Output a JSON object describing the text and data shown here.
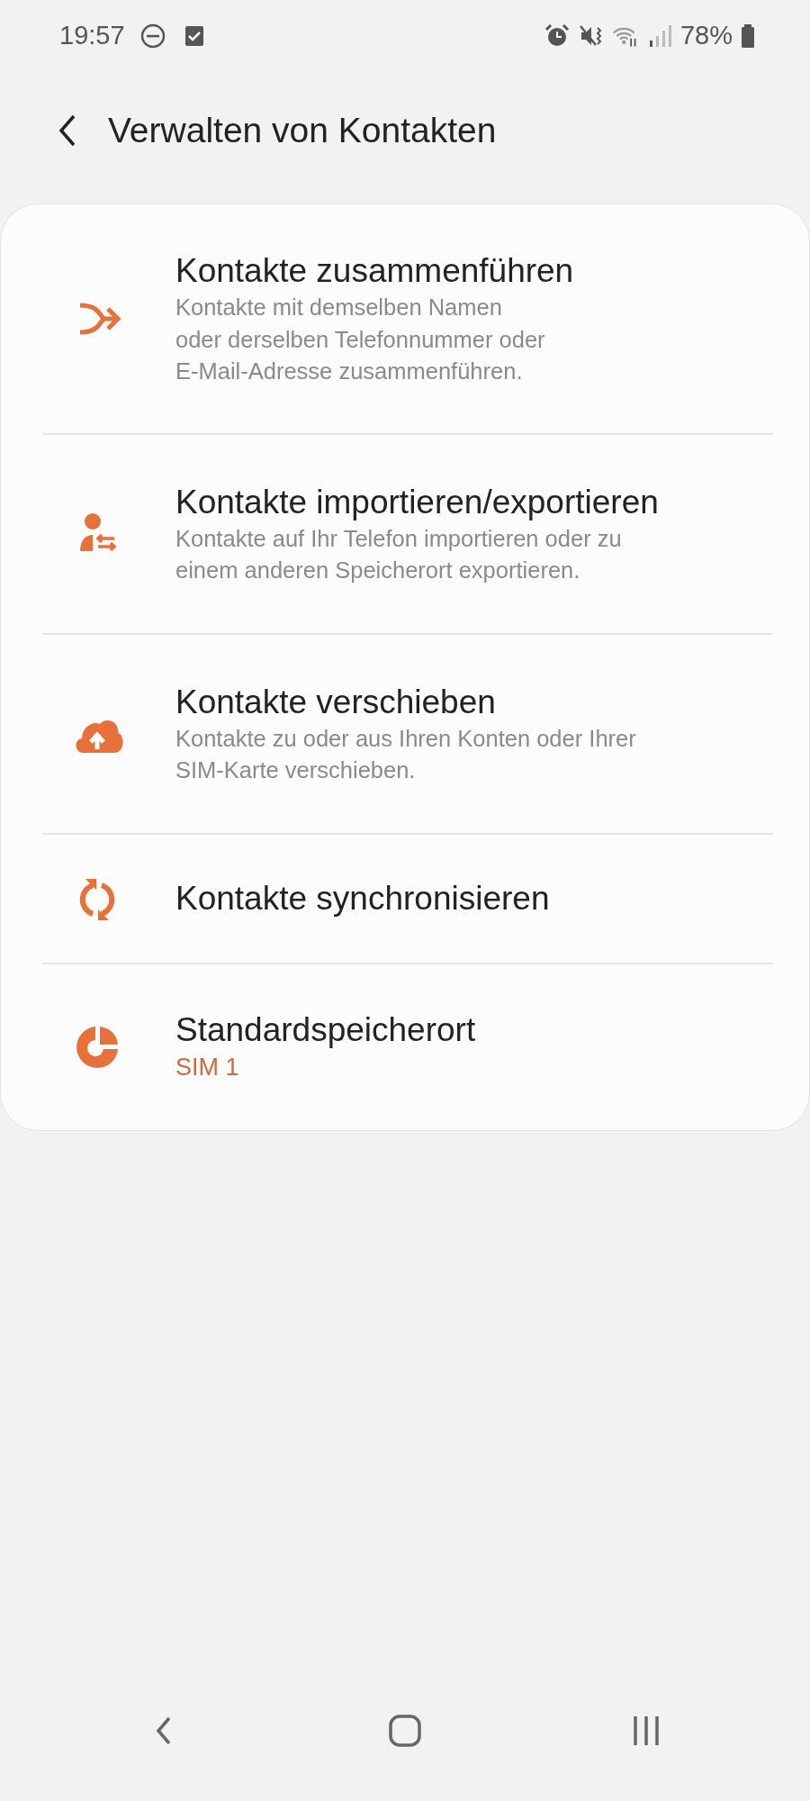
{
  "status_bar": {
    "time": "19:57",
    "battery": "78%"
  },
  "header": {
    "title": "Verwalten von Kontakten"
  },
  "items": [
    {
      "title": "Kontakte zusammenführen",
      "subtitle": "Kontakte mit demselben Namen\noder derselben Telefonnummer oder\nE-Mail-Adresse zusammenführen."
    },
    {
      "title": "Kontakte importieren/exportieren",
      "subtitle": "Kontakte auf Ihr Telefon importieren oder zu\neinem anderen Speicherort exportieren."
    },
    {
      "title": "Kontakte verschieben",
      "subtitle": "Kontakte zu oder aus Ihren Konten oder Ihrer\nSIM-Karte verschieben."
    },
    {
      "title": "Kontakte synchronisieren"
    },
    {
      "title": "Standardspeicherort",
      "value": "SIM 1"
    }
  ]
}
